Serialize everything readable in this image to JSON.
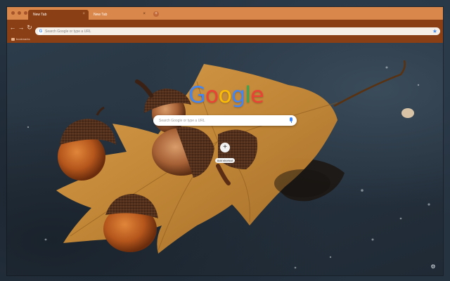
{
  "browser": {
    "tabs": [
      {
        "label": "New Tab",
        "active": true
      },
      {
        "label": "New Tab",
        "active": false
      }
    ],
    "new_tab_symbol": "+",
    "close_symbol": "×",
    "omnibox": {
      "placeholder": "Search Google or type a URL"
    },
    "bookmarks": [
      {
        "label": "bookmarks",
        "icon": "folder-icon"
      }
    ],
    "nav": {
      "back": "←",
      "forward": "→",
      "reload": "↻"
    },
    "bookmark_star": "★"
  },
  "newtab": {
    "logo_letters": [
      {
        "char": "G",
        "color": "#4285f4"
      },
      {
        "char": "o",
        "color": "#ea4335"
      },
      {
        "char": "o",
        "color": "#fbbc05"
      },
      {
        "char": "g",
        "color": "#4285f4"
      },
      {
        "char": "l",
        "color": "#34a853"
      },
      {
        "char": "e",
        "color": "#ea4335"
      }
    ],
    "search_placeholder": "Search Google or type a URL",
    "shortcut": {
      "symbol": "+",
      "label": "Add shortcut"
    },
    "customize_icon": "gear-icon",
    "customize_symbol": "⚙"
  },
  "theme": {
    "frame_color": "#d9874a",
    "toolbar_color": "#8a3f14",
    "background": "acorns on autumn leaf"
  }
}
